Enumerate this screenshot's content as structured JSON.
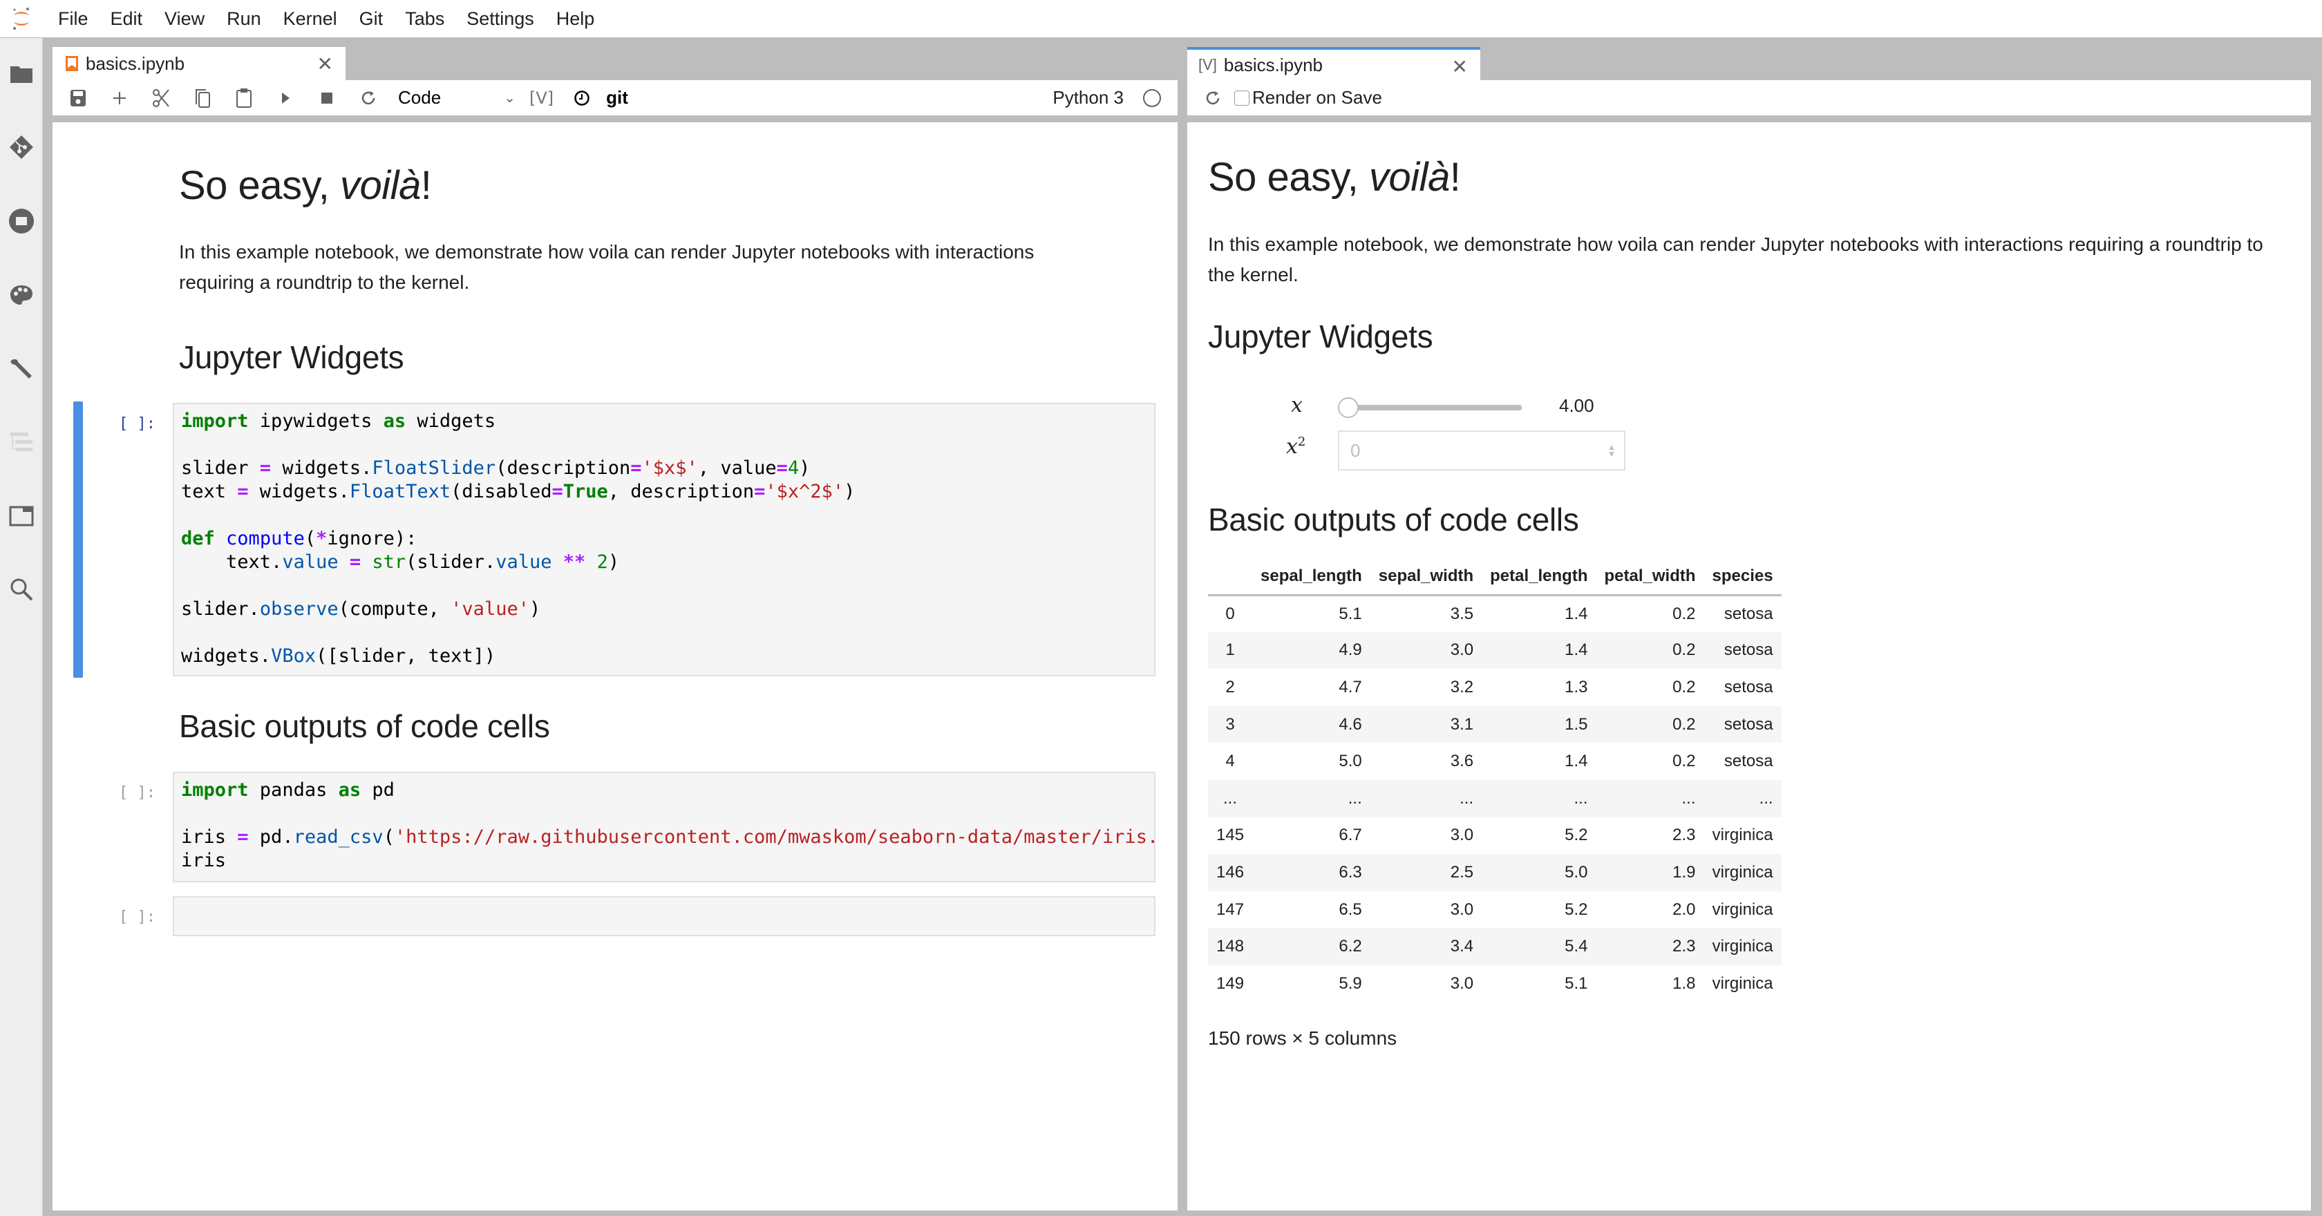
{
  "menubar": {
    "items": [
      "File",
      "Edit",
      "View",
      "Run",
      "Kernel",
      "Git",
      "Tabs",
      "Settings",
      "Help"
    ]
  },
  "sidebar": {
    "icons": [
      "folder-icon",
      "git-icon",
      "running-icon",
      "palette-icon",
      "wrench-icon",
      "toc-icon",
      "tabs-icon",
      "search-icon"
    ]
  },
  "left_panel": {
    "tab_title": "basics.ipynb",
    "toolbar": {
      "cell_type": "Code",
      "voila_label": "[V]",
      "git_label": "git",
      "kernel_name": "Python 3"
    },
    "notebook": {
      "title_prefix": "So easy, ",
      "title_italic": "voilà",
      "title_suffix": "!",
      "intro": "In this example notebook, we demonstrate how voila can render Jupyter notebooks with interactions requiring a roundtrip to the kernel.",
      "heading_widgets": "Jupyter Widgets",
      "heading_outputs": "Basic outputs of code cells",
      "prompt": "[ ]:",
      "cell1_lines": [
        "import ipywidgets as widgets",
        "",
        "slider = widgets.FloatSlider(description='$x$', value=4)",
        "text = widgets.FloatText(disabled=True, description='$x^2$')",
        "",
        "def compute(*ignore):",
        "    text.value = str(slider.value ** 2)",
        "",
        "slider.observe(compute, 'value')",
        "",
        "widgets.VBox([slider, text])"
      ],
      "cell2_lines": [
        "import pandas as pd",
        "",
        "iris = pd.read_csv('https://raw.githubusercontent.com/mwaskom/seaborn-data/master/iris.csv",
        "iris"
      ],
      "cell3_lines": [
        ""
      ]
    }
  },
  "right_panel": {
    "tab_prefix": "[V]",
    "tab_title": "basics.ipynb",
    "render_on_save_label": "Render on Save",
    "render_on_save_checked": false,
    "preview": {
      "title_prefix": "So easy, ",
      "title_italic": "voilà",
      "title_suffix": "!",
      "intro": "In this example notebook, we demonstrate how voila can render Jupyter notebooks with interactions requiring a roundtrip to the kernel.",
      "heading_widgets": "Jupyter Widgets",
      "slider": {
        "label": "x",
        "value_text": "4.00",
        "fraction": 0.0
      },
      "float_text": {
        "label_base": "x",
        "label_sup": "2",
        "value": "0"
      },
      "heading_outputs": "Basic outputs of code cells",
      "table": {
        "columns": [
          "",
          "sepal_length",
          "sepal_width",
          "petal_length",
          "petal_width",
          "species"
        ],
        "rows": [
          [
            "0",
            "5.1",
            "3.5",
            "1.4",
            "0.2",
            "setosa"
          ],
          [
            "1",
            "4.9",
            "3.0",
            "1.4",
            "0.2",
            "setosa"
          ],
          [
            "2",
            "4.7",
            "3.2",
            "1.3",
            "0.2",
            "setosa"
          ],
          [
            "3",
            "4.6",
            "3.1",
            "1.5",
            "0.2",
            "setosa"
          ],
          [
            "4",
            "5.0",
            "3.6",
            "1.4",
            "0.2",
            "setosa"
          ],
          [
            "...",
            "...",
            "...",
            "...",
            "...",
            "..."
          ],
          [
            "145",
            "6.7",
            "3.0",
            "5.2",
            "2.3",
            "virginica"
          ],
          [
            "146",
            "6.3",
            "2.5",
            "5.0",
            "1.9",
            "virginica"
          ],
          [
            "147",
            "6.5",
            "3.0",
            "5.2",
            "2.0",
            "virginica"
          ],
          [
            "148",
            "6.2",
            "3.4",
            "5.4",
            "2.3",
            "virginica"
          ],
          [
            "149",
            "5.9",
            "3.0",
            "5.1",
            "1.8",
            "virginica"
          ]
        ],
        "footer": "150 rows × 5 columns"
      }
    }
  },
  "colors": {
    "accent_blue": "#4a90e2",
    "jupyter_orange": "#f37726"
  }
}
